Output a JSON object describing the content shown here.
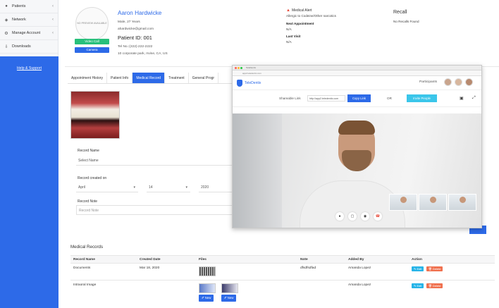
{
  "sidebar": {
    "items": [
      {
        "label": "Patients",
        "icon": "users-icon"
      },
      {
        "label": "Network",
        "icon": "network-icon"
      },
      {
        "label": "Manage Account",
        "icon": "gear-icon"
      },
      {
        "label": "Downloads",
        "icon": "download-icon"
      }
    ],
    "help_link": "Help & Support"
  },
  "patient": {
    "no_preview": "NO PREVIEW AVAILABLE",
    "video_call": "Video Call",
    "camera": "Camera",
    "name": "Aaron Hardwicke",
    "gender_age": "Male, 27 Years",
    "email": "ahardwicke@gmail.com",
    "id_label": "Patient ID: 001",
    "tel": "Tel No.:(222)-222-2222",
    "address": "10 corporate park, Irvine, CA, US"
  },
  "alert": {
    "title": "Medical Alert",
    "text": "Allergic to Codeine/Other narcotics",
    "next_label": "Next Appointment",
    "next_value": "N/A",
    "last_label": "Last Visit",
    "last_value": "N/A"
  },
  "recall": {
    "title": "Recall",
    "text": "No Recalls Found"
  },
  "tabs": [
    "Appointment History",
    "Patient Info",
    "Medical Record",
    "Treatment",
    "General Progr"
  ],
  "form": {
    "record_name_label": "Record Name",
    "record_name_value": "Select Name",
    "created_on_label": "Record created on",
    "month": "April",
    "day": "14",
    "year": "2020",
    "note_label": "Record Note",
    "note_placeholder": "Record Note"
  },
  "medical_records": {
    "title": "Medical Records",
    "columns": [
      "Record Name",
      "Created Date",
      "Files",
      "Note",
      "Added By",
      "Action"
    ],
    "rows": [
      {
        "name": "Documents",
        "date": "Mar 18, 2020",
        "note": "dfsdfsdfad",
        "added_by": "Amanda Lopez"
      },
      {
        "name": "Intraoral Image",
        "date": "",
        "note": "",
        "added_by": "Amanda Lopez"
      }
    ],
    "edit": "Edit",
    "delete": "Delete",
    "new": "New"
  },
  "video_call": {
    "tab_label": "TeleDentix",
    "url": "app2.teledentix.com",
    "brand": "TeleDentix",
    "participants_label": "Participants",
    "shareable_label": "Shareable Link",
    "share_url": "http://app2.teledentix.com",
    "copy_button": "Copy Link",
    "or_label": "OR",
    "invite_button": "Invite People"
  },
  "colors": {
    "primary": "#2d6ae8",
    "success": "#28c07b",
    "danger": "#e74c3c",
    "cyan": "#3bc6ea"
  }
}
